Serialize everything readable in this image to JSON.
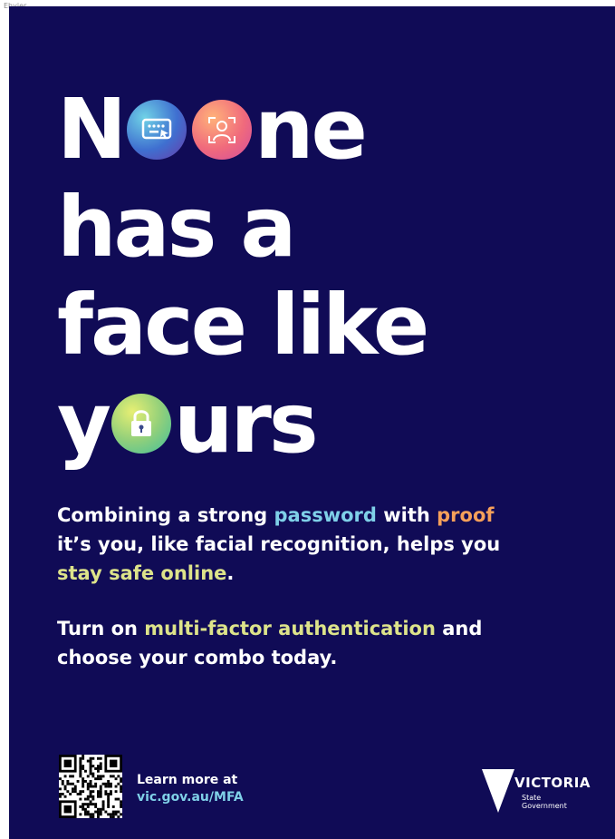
{
  "corner_label": "Ehvier",
  "headline": {
    "line1_a": "N",
    "line1_b": "ne",
    "line2": "has a",
    "line3": "face like",
    "line4_a": "y",
    "line4_b": "urs"
  },
  "icons": {
    "keyboard": "keyboard-icon",
    "face": "face-recognition-icon",
    "lock": "padlock-icon"
  },
  "paragraph1": {
    "t1": "Combining a strong ",
    "h1": "password",
    "t2": " with ",
    "h2": "proof",
    "t3": " it’s you, like facial recognition, helps you ",
    "h3": "stay safe online",
    "t4": "."
  },
  "paragraph2": {
    "t1": "Turn on ",
    "h1": "multi-factor authentication",
    "t2": " and choose your combo today."
  },
  "footer": {
    "learn_more": "Learn more at",
    "url": "vic.gov.au/MFA",
    "logo_word": "VICTORIA",
    "logo_sub_1": "State",
    "logo_sub_2": "Government"
  },
  "colors": {
    "background": "#100b56",
    "accent_blue": "#7fd0e8",
    "accent_orange": "#f6a05a",
    "accent_yellow": "#dde38a"
  }
}
